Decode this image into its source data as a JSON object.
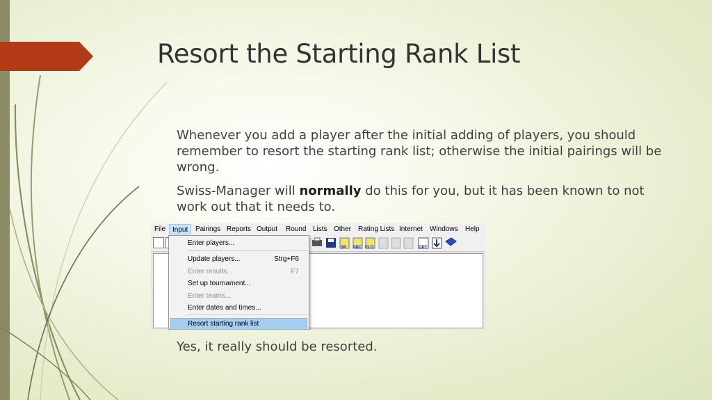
{
  "slide": {
    "title": "Resort the Starting Rank List",
    "bullets": [
      {
        "text": "Whenever you add a player after the initial adding of players, you should remember to resort the starting rank list; otherwise the initial pairings will be wrong."
      },
      {
        "before": "Swiss-Manager will ",
        "bold": "normally",
        "after": " do this for you, but it has been known to not work out that it needs to."
      },
      {
        "text": "Yes, it really should be resorted."
      }
    ],
    "bullet_glyph": "",
    "accent_color": "#b23a17"
  },
  "app": {
    "menu": [
      "File",
      "Input",
      "Pairings",
      "Reports",
      "Output",
      "Round",
      "Lists",
      "Other",
      "Rating Lists",
      "Internet",
      "Windows",
      "Help"
    ],
    "active_menu": "Input",
    "toolbar_labels": [
      "SP",
      "ABC",
      "ELO",
      "OPT"
    ],
    "dropdown": [
      {
        "label": "Enter players...",
        "shortcut": "",
        "enabled": true
      },
      {
        "label": "Update players...",
        "shortcut": "Strg+F6",
        "enabled": true
      },
      {
        "label": "Enter results...",
        "shortcut": "F7",
        "enabled": false
      },
      {
        "label": "Set up tournament...",
        "shortcut": "",
        "enabled": true
      },
      {
        "label": "Enter teams...",
        "shortcut": "",
        "enabled": false
      },
      {
        "label": "Enter dates and times...",
        "shortcut": "",
        "enabled": true
      },
      {
        "label": "Resort starting rank list",
        "shortcut": "",
        "enabled": true,
        "highlighted": true
      }
    ]
  }
}
